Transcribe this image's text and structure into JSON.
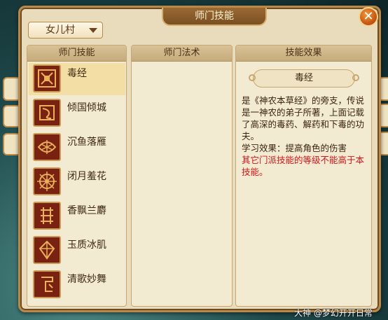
{
  "window": {
    "title": "师门技能",
    "close_label": "✕"
  },
  "school_dropdown": {
    "selected": "女儿村"
  },
  "columns": {
    "skills_header": "师门技能",
    "methods_header": "师门法术",
    "effect_header": "技能效果"
  },
  "skills": [
    {
      "name": "毒经",
      "icon": "poison-scroll-icon",
      "selected": true
    },
    {
      "name": "倾国倾城",
      "icon": "charm-icon",
      "selected": false
    },
    {
      "name": "沉鱼落雁",
      "icon": "fish-goose-icon",
      "selected": false
    },
    {
      "name": "闭月羞花",
      "icon": "moon-flower-icon",
      "selected": false
    },
    {
      "name": "香飘兰麝",
      "icon": "fragrance-icon",
      "selected": false
    },
    {
      "name": "玉质冰肌",
      "icon": "jade-skin-icon",
      "selected": false
    },
    {
      "name": "清歌妙舞",
      "icon": "dance-icon",
      "selected": false
    }
  ],
  "effect": {
    "title": "毒经",
    "description": "是《神农本草经》的旁支，传说是一神农的弟子所著，上面记载了高深的毒药、解药和下毒的功夫。",
    "learn_effect": "学习效果：提高角色的伤害",
    "warning": "其它门派技能的等级不能高于本技能。"
  },
  "watermark": "大神 @梦幻开开日常",
  "colors": {
    "panel_bg": "#e9dcbc",
    "selected_row": "#f3dfa6",
    "warning_red": "#d2141a",
    "icon_bg": "#7a2212"
  }
}
